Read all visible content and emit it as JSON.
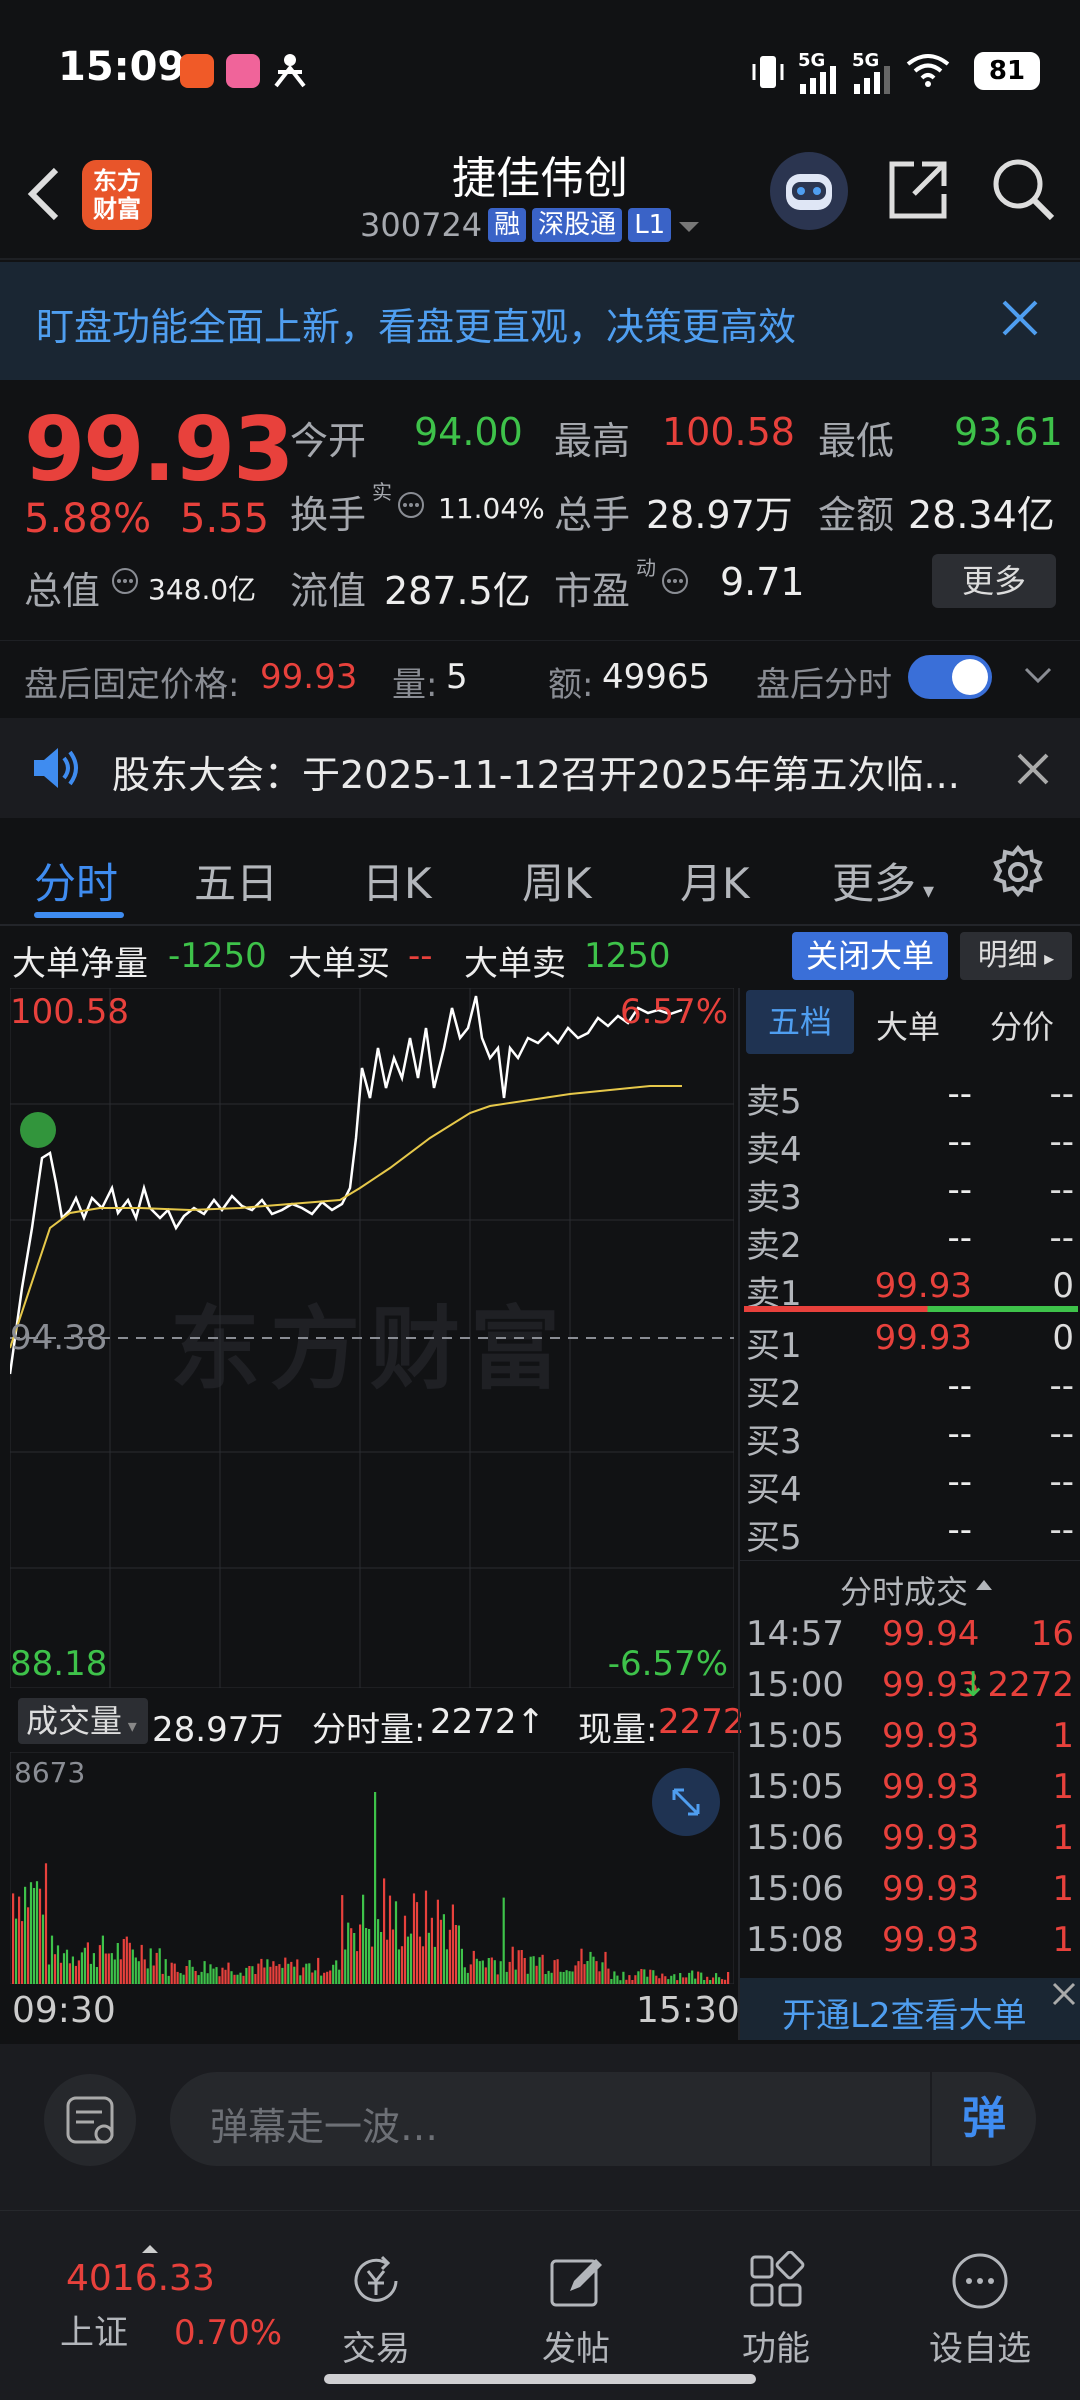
{
  "status_bar": {
    "time": "15:09",
    "battery": "81",
    "net1": "5G",
    "net2": "5G"
  },
  "header": {
    "logo_line1": "东方",
    "logo_line2": "财富",
    "stock_name": "捷佳伟创",
    "stock_code": "300724",
    "tag_rong": "融",
    "tag_sgt": "深股通",
    "tag_level": "L1"
  },
  "banner": {
    "text": "盯盘功能全面上新，看盘更直观，决策更高效"
  },
  "quote": {
    "price": "99.93",
    "change_pct": "5.88%",
    "change": "5.55",
    "open_label": "今开",
    "open": "94.00",
    "high_label": "最高",
    "high": "100.58",
    "low_label": "最低",
    "low": "93.61",
    "turnover_label": "换手",
    "turnover_sup": "实",
    "turnover": "11.04%",
    "volume_label": "总手",
    "volume": "28.97万",
    "amount_label": "金额",
    "amount": "28.34亿",
    "mktcap_label": "总值",
    "mktcap": "348.0亿",
    "float_label": "流值",
    "float": "287.5亿",
    "pe_label": "市盈",
    "pe_sup": "动",
    "pe": "9.71",
    "more": "更多"
  },
  "after_hours": {
    "price_label": "盘后固定价格:",
    "price": "99.93",
    "vol_label": "量:",
    "vol": "5",
    "amt_label": "额:",
    "amt": "49965",
    "switch_label": "盘后分时"
  },
  "notice": {
    "text": "股东大会：于2025-11-12召开2025年第五次临..."
  },
  "tabs": [
    "分时",
    "五日",
    "日K",
    "周K",
    "月K",
    "更多"
  ],
  "big_order": {
    "net_label": "大单净量",
    "net": "-1250",
    "buy_label": "大单买",
    "buy": "--",
    "sell_label": "大单卖",
    "sell": "1250",
    "close_btn": "关闭大单",
    "detail_btn": "明细"
  },
  "chart": {
    "price_high": "100.58",
    "pct_high": "6.57%",
    "price_base": "94.38",
    "price_low": "88.18",
    "pct_low": "-6.57%",
    "watermark": "东方财富",
    "time_start": "09:30",
    "time_end": "15:30"
  },
  "volume_bar": {
    "label": "成交量",
    "total": "28.97万",
    "minute_label": "分时量:",
    "minute": "2272↑",
    "current_label": "现量:",
    "current": "2272",
    "max": "8673"
  },
  "panel": {
    "tabs": [
      "五档",
      "大单",
      "分价"
    ],
    "sells": [
      {
        "name": "卖5",
        "price": "--",
        "vol": "--"
      },
      {
        "name": "卖4",
        "price": "--",
        "vol": "--"
      },
      {
        "name": "卖3",
        "price": "--",
        "vol": "--"
      },
      {
        "name": "卖2",
        "price": "--",
        "vol": "--"
      },
      {
        "name": "卖1",
        "price": "99.93",
        "vol": "0"
      }
    ],
    "buys": [
      {
        "name": "买1",
        "price": "99.93",
        "vol": "0"
      },
      {
        "name": "买2",
        "price": "--",
        "vol": "--"
      },
      {
        "name": "买3",
        "price": "--",
        "vol": "--"
      },
      {
        "name": "买4",
        "price": "--",
        "vol": "--"
      },
      {
        "name": "买5",
        "price": "--",
        "vol": "--"
      }
    ],
    "trades_title": "分时成交",
    "trades": [
      {
        "time": "14:57",
        "price": "99.94",
        "vol": "16"
      },
      {
        "time": "15:00",
        "price": "99.93",
        "vol": "↓2272"
      },
      {
        "time": "15:05",
        "price": "99.93",
        "vol": "1"
      },
      {
        "time": "15:05",
        "price": "99.93",
        "vol": "1"
      },
      {
        "time": "15:06",
        "price": "99.93",
        "vol": "1"
      },
      {
        "time": "15:06",
        "price": "99.93",
        "vol": "1"
      },
      {
        "time": "15:08",
        "price": "99.93",
        "vol": "1"
      }
    ],
    "l2": "开通L2查看大单"
  },
  "comment": {
    "placeholder": "弹幕走一波…",
    "dan": "弹"
  },
  "nav": {
    "index_value": "4016.33",
    "index_name": "上证",
    "index_pct": "0.70%",
    "items": [
      "交易",
      "发帖",
      "功能",
      "设自选"
    ]
  },
  "colors": {
    "up": "#e8413c",
    "down": "#3ec24a",
    "accent": "#3f8cf0",
    "bg": "#111214"
  }
}
